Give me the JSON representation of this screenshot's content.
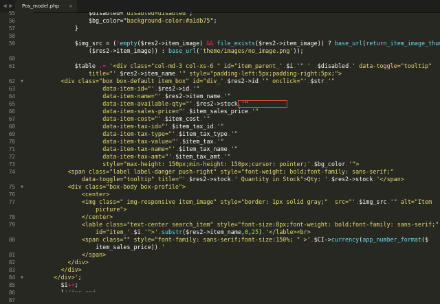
{
  "tab": {
    "title": "Pos_model.php",
    "close_glyph": "×"
  },
  "nav": {
    "left_glyph": "◀",
    "right_glyph": "▶"
  },
  "lines": [
    {
      "n": "55",
      "fold": "",
      "indent": 16,
      "segs": [
        [
          "v",
          "$disabled"
        ],
        [
          "t",
          "=\""
        ],
        [
          "s",
          "disabled=disabled"
        ],
        [
          "t",
          "\";"
        ]
      ]
    },
    {
      "n": "56",
      "fold": "",
      "indent": 16,
      "segs": [
        [
          "v",
          "$bg_color"
        ],
        [
          "t",
          "=\""
        ],
        [
          "s",
          "background-color:#a1db75"
        ],
        [
          "t",
          "\";"
        ]
      ]
    },
    {
      "n": "57",
      "fold": "",
      "indent": 12,
      "segs": [
        [
          "t",
          "}"
        ]
      ]
    },
    {
      "n": "58",
      "fold": "",
      "indent": 0,
      "segs": []
    },
    {
      "n": "59",
      "fold": "",
      "indent": 12,
      "segs": [
        [
          "v",
          "$img_src"
        ],
        [
          "t",
          " = ("
        ],
        [
          "k",
          "!"
        ],
        [
          "f",
          "empty"
        ],
        [
          "t",
          "($res2->item_image) "
        ],
        [
          "k",
          "&&"
        ],
        [
          "t",
          " "
        ],
        [
          "f",
          "file_exists"
        ],
        [
          "t",
          "($res2->item_image)) ? "
        ],
        [
          "f",
          "base_url"
        ],
        [
          "t",
          "("
        ],
        [
          "f",
          "return_item_image_thumb"
        ]
      ]
    },
    {
      "n": "",
      "fold": "",
      "indent": 16,
      "segs": [
        [
          "t",
          "($res2->item_image)) : "
        ],
        [
          "f",
          "base_url"
        ],
        [
          "t",
          "("
        ],
        [
          "s",
          "'theme/images/no_image.png'"
        ],
        [
          "t",
          "));"
        ]
      ]
    },
    {
      "n": "60",
      "fold": "",
      "indent": 0,
      "segs": []
    },
    {
      "n": "61",
      "fold": "",
      "indent": 12,
      "segs": [
        [
          "v",
          "$table"
        ],
        [
          "t",
          " "
        ],
        [
          "k",
          ".="
        ],
        [
          "t",
          " "
        ],
        [
          "s",
          "'<div class=\"col-md-3 col-xs-6 \" id=\"item_parent_'"
        ],
        [
          "k",
          "."
        ],
        [
          "t",
          "$i"
        ],
        [
          "k",
          "."
        ],
        [
          "s",
          "'\" '"
        ],
        [
          "t",
          " "
        ],
        [
          "k",
          "."
        ],
        [
          "v",
          "$disabled"
        ],
        [
          "k",
          "."
        ],
        [
          "s",
          "' data-toggle=\"tooltip\""
        ]
      ]
    },
    {
      "n": "",
      "fold": "",
      "indent": 16,
      "segs": [
        [
          "s",
          "title=\"'"
        ],
        [
          "k",
          "."
        ],
        [
          "t",
          "$res2->item_name"
        ],
        [
          "k",
          "."
        ],
        [
          "s",
          "'\" style=\"padding-left:5px;padding-right:5px;\">"
        ]
      ]
    },
    {
      "n": "62",
      "fold": "▼",
      "indent": 8,
      "segs": [
        [
          "s",
          "<div class=\"box box-default item_box\" id=\"div_'"
        ],
        [
          "k",
          "."
        ],
        [
          "t",
          "$res2->id"
        ],
        [
          "k",
          "."
        ],
        [
          "s",
          "'\" onclick=\"'"
        ],
        [
          "k",
          "."
        ],
        [
          "t",
          "$str"
        ],
        [
          "k",
          "."
        ],
        [
          "s",
          "'\""
        ]
      ]
    },
    {
      "n": "63",
      "fold": "",
      "indent": 20,
      "segs": [
        [
          "s",
          "data-item-id=\"'"
        ],
        [
          "k",
          "."
        ],
        [
          "t",
          "$res2->id"
        ],
        [
          "k",
          "."
        ],
        [
          "s",
          "'\""
        ]
      ]
    },
    {
      "n": "64",
      "fold": "",
      "indent": 20,
      "segs": [
        [
          "s",
          "data-item-name=\"'"
        ],
        [
          "k",
          "."
        ],
        [
          "t",
          "$res2->item_name"
        ],
        [
          "k",
          "."
        ],
        [
          "s",
          "'\""
        ]
      ]
    },
    {
      "n": "65",
      "fold": "",
      "indent": 20,
      "segs": [
        [
          "s",
          "data-item-available-qty=\"'"
        ],
        [
          "k",
          "."
        ],
        [
          "t",
          "$res2->stock"
        ],
        [
          "k",
          "."
        ],
        [
          "s",
          "'\""
        ]
      ]
    },
    {
      "n": "66",
      "fold": "",
      "indent": 20,
      "segs": [
        [
          "s",
          "data-item-sales-price=\"'"
        ],
        [
          "k",
          "."
        ],
        [
          "t",
          "$item_sales_price"
        ],
        [
          "k",
          "."
        ],
        [
          "s",
          "'\""
        ]
      ]
    },
    {
      "n": "67",
      "fold": "",
      "indent": 20,
      "segs": [
        [
          "s",
          "data-item-cost=\"'"
        ],
        [
          "k",
          "."
        ],
        [
          "t",
          "$item_cost"
        ],
        [
          "k",
          "."
        ],
        [
          "s",
          "'\""
        ]
      ]
    },
    {
      "n": "68",
      "fold": "",
      "indent": 20,
      "segs": [
        [
          "s",
          "data-item-tax-id=\"'"
        ],
        [
          "k",
          "."
        ],
        [
          "t",
          "$item_tax_id"
        ],
        [
          "k",
          "."
        ],
        [
          "s",
          "'\""
        ]
      ]
    },
    {
      "n": "69",
      "fold": "",
      "indent": 20,
      "segs": [
        [
          "s",
          "data-item-tax-type=\"'"
        ],
        [
          "k",
          "."
        ],
        [
          "t",
          "$item_tax_type"
        ],
        [
          "k",
          "."
        ],
        [
          "s",
          "'\""
        ]
      ]
    },
    {
      "n": "70",
      "fold": "",
      "indent": 20,
      "segs": [
        [
          "s",
          "data-item-tax-value=\"'"
        ],
        [
          "k",
          "."
        ],
        [
          "t",
          "$item_tax"
        ],
        [
          "k",
          "."
        ],
        [
          "s",
          "'\""
        ]
      ]
    },
    {
      "n": "71",
      "fold": "",
      "indent": 20,
      "segs": [
        [
          "s",
          "data-item-tax-name=\"'"
        ],
        [
          "k",
          "."
        ],
        [
          "t",
          "$item_tax_name"
        ],
        [
          "k",
          "."
        ],
        [
          "s",
          "'\""
        ]
      ]
    },
    {
      "n": "72",
      "fold": "",
      "indent": 20,
      "segs": [
        [
          "s",
          "data-item-tax-amt=\"'"
        ],
        [
          "k",
          "."
        ],
        [
          "t",
          "$item_tax_amt"
        ],
        [
          "k",
          "."
        ],
        [
          "s",
          "'\""
        ]
      ]
    },
    {
      "n": "73",
      "fold": "",
      "indent": 20,
      "segs": [
        [
          "s",
          "style=\"max-height: 150px;min-height: 150px;cursor: pointer;'"
        ],
        [
          "k",
          "."
        ],
        [
          "t",
          "$bg_color"
        ],
        [
          "k",
          "."
        ],
        [
          "s",
          "'\">"
        ]
      ]
    },
    {
      "n": "74",
      "fold": "",
      "indent": 10,
      "segs": [
        [
          "s",
          "<span class=\"label label-danger push-right\" style=\"font-weight: bold;font-family: sans-serif;\""
        ]
      ]
    },
    {
      "n": "",
      "fold": "",
      "indent": 14,
      "segs": [
        [
          "s",
          "data-toggle=\"tooltip\" title=\"'"
        ],
        [
          "k",
          "."
        ],
        [
          "t",
          "$res2->stock"
        ],
        [
          "k",
          "."
        ],
        [
          "s",
          "' Quantity in Stock\">Qty: '"
        ],
        [
          "k",
          "."
        ],
        [
          "t",
          "$res2->stock"
        ],
        [
          "k",
          "."
        ],
        [
          "s",
          "'</span>"
        ]
      ]
    },
    {
      "n": "75",
      "fold": "▼",
      "indent": 10,
      "segs": [
        [
          "s",
          "<div class=\"box-body box-profile\">"
        ]
      ]
    },
    {
      "n": "76",
      "fold": "",
      "indent": 14,
      "segs": [
        [
          "s",
          "<center>"
        ]
      ]
    },
    {
      "n": "77",
      "fold": "",
      "indent": 14,
      "segs": [
        [
          "s",
          "<img class=\" img-responsive item_image\" style=\"border: 1px solid gray;\"  src=\"'"
        ],
        [
          "k",
          "."
        ],
        [
          "t",
          "$img_src"
        ],
        [
          "k",
          "."
        ],
        [
          "s",
          "'\" alt=\"Item"
        ]
      ]
    },
    {
      "n": "",
      "fold": "",
      "indent": 18,
      "segs": [
        [
          "s",
          "picture\">"
        ]
      ]
    },
    {
      "n": "78",
      "fold": "",
      "indent": 14,
      "segs": [
        [
          "s",
          "</center>"
        ]
      ]
    },
    {
      "n": "79",
      "fold": "",
      "indent": 14,
      "segs": [
        [
          "s",
          "<lable class=\"text-center search_item\" style=\"font-size:8px;font-weight: bold;font-family: sans-serif;\""
        ]
      ]
    },
    {
      "n": "",
      "fold": "",
      "indent": 18,
      "segs": [
        [
          "s",
          "id=\"item_'"
        ],
        [
          "k",
          "."
        ],
        [
          "t",
          "$i"
        ],
        [
          "k",
          "."
        ],
        [
          "s",
          "'\">'"
        ],
        [
          "k",
          "."
        ],
        [
          "f",
          "substr"
        ],
        [
          "t",
          "($res2->item_name,"
        ],
        [
          "at",
          "0"
        ],
        [
          "t",
          ","
        ],
        [
          "at",
          "25"
        ],
        [
          "t",
          ")"
        ],
        [
          "k",
          "."
        ],
        [
          "s",
          "'</lable><br>"
        ]
      ]
    },
    {
      "n": "80",
      "fold": "",
      "indent": 14,
      "segs": [
        [
          "s",
          "<span class=\"\" style=\"font-family: sans-serif;font-size:150%; \" >'"
        ],
        [
          "k",
          "."
        ],
        [
          "t",
          "$CI->"
        ],
        [
          "f",
          "currency"
        ],
        [
          "t",
          "("
        ],
        [
          "f",
          "app_number_format"
        ],
        [
          "t",
          "($"
        ]
      ]
    },
    {
      "n": "",
      "fold": "",
      "indent": 18,
      "segs": [
        [
          "t",
          "item_sales_price))"
        ],
        [
          "k",
          "."
        ],
        [
          "s",
          "'"
        ]
      ]
    },
    {
      "n": "81",
      "fold": "",
      "indent": 14,
      "segs": [
        [
          "s",
          "</span>"
        ]
      ]
    },
    {
      "n": "82",
      "fold": "",
      "indent": 10,
      "segs": [
        [
          "s",
          "</div>"
        ]
      ]
    },
    {
      "n": "83",
      "fold": "",
      "indent": 8,
      "segs": [
        [
          "s",
          "</div>"
        ]
      ]
    },
    {
      "n": "84",
      "fold": "▼",
      "indent": 6,
      "segs": [
        [
          "s",
          "</div>'"
        ],
        [
          "t",
          ";"
        ]
      ]
    },
    {
      "n": "85",
      "fold": "",
      "indent": 8,
      "segs": [
        [
          "v",
          "$i"
        ],
        [
          "k",
          "++"
        ],
        [
          "t",
          ";"
        ]
      ]
    },
    {
      "n": "86",
      "fold": "",
      "indent": 8,
      "segs": [
        [
          "t",
          "}"
        ],
        [
          "c",
          "//for end"
        ]
      ]
    },
    {
      "n": "87",
      "fold": "",
      "indent": 8,
      "segs": [
        [
          "k",
          "return"
        ],
        [
          "t",
          " $table;"
        ]
      ]
    }
  ]
}
